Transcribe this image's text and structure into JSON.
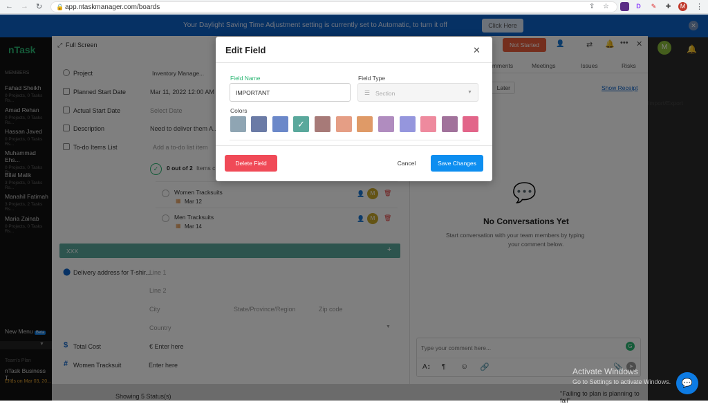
{
  "browser": {
    "url": "app.ntaskmanager.com/boards",
    "extensions": [
      "D",
      "M"
    ]
  },
  "banner": {
    "message": "Your Daylight Saving Time Adjustment setting is currently set to Automatic, to turn it off",
    "button": "Click Here"
  },
  "leftnav": {
    "logo": "nTask",
    "section": "MEMBERS",
    "members": [
      {
        "name": "Fahad Sheikh",
        "sub": "0 Projects, 0 Tasks Rs..."
      },
      {
        "name": "Amad Rehan",
        "sub": "0 Projects, 0 Tasks Rs..."
      },
      {
        "name": "Hassan Javed",
        "sub": "0 Projects, 0 Tasks Rs..."
      },
      {
        "name": "Muhammad Ehs...",
        "sub": "0 Projects, 0 Tasks Rs..."
      },
      {
        "name": "Bilal Malik",
        "sub": "3 Projects, 0 Tasks Rs..."
      },
      {
        "name": "Manahil Fatimah",
        "sub": "3 Projects, 2 Tasks Rs..."
      },
      {
        "name": "Maria Zainab",
        "sub": "0 Projects, 0 Tasks Rs..."
      }
    ],
    "new_menu": "New Menu",
    "beta": "Beta",
    "team_plan_label": "Team's Plan",
    "plan_name": "nTask Business T...",
    "plan_ends": "Ends on Mar 03, 20..."
  },
  "panel": {
    "full_screen": "Full Screen",
    "not_started": "Not Started",
    "avatar": "M",
    "tabs": [
      "Comments",
      "Meetings",
      "Issues",
      "Risks"
    ],
    "later": "Later",
    "show_receipt": "Show Receipt",
    "import_export": "Import/Export",
    "fields": [
      {
        "label": "Project",
        "value": "Inventory Manage..."
      },
      {
        "label": "Planned Start Date",
        "value": "Mar 11, 2022 12:00 AM"
      },
      {
        "label": "Actual Start Date",
        "value": "Select Date"
      },
      {
        "label": "Description",
        "value": "Need to deliver them A..."
      },
      {
        "label": "To-do Items List",
        "value": "Add a to-do list item"
      }
    ],
    "todo_progress": "0 out of 2",
    "todo_progress_suffix": "Items c...",
    "todos": [
      {
        "name": "Women Tracksuits",
        "date": "Mar 12"
      },
      {
        "name": "Men Tracksuits",
        "date": "Mar 14"
      }
    ],
    "section_bar": "XXX",
    "delivery_label": "Delivery address for T-shir...",
    "address": {
      "line1": "Line 1",
      "line2": "Line 2",
      "city": "City",
      "state": "State/Province/Region",
      "zip": "Zip code",
      "country": "Country"
    },
    "total_cost_label": "Total Cost",
    "total_cost_value": "€ Enter here",
    "women_tracksuit_label": "Women Tracksuit",
    "women_tracksuit_value": "Enter here",
    "no_conv_title": "No Conversations Yet",
    "no_conv_text_1": "Start conversation with your team members by typing",
    "no_conv_text_2": "your comment below.",
    "comment_placeholder": "Type your comment here...",
    "showing": "Showing 5 Status(s)",
    "quote": "\"Failing to plan is planning to fail\""
  },
  "activate": {
    "title": "Activate Windows",
    "sub": "Go to Settings to activate Windows."
  },
  "modal": {
    "title": "Edit Field",
    "field_name_label": "Field Name",
    "field_name_value": "IMPORTANT",
    "field_type_label": "Field Type",
    "field_type_value": "Section",
    "colors_label": "Colors",
    "colors": [
      "#8fa5b3",
      "#6b7ba6",
      "#6b88c9",
      "#5aa89c",
      "#a77a78",
      "#e59e85",
      "#df9a67",
      "#b08cbf",
      "#9596dd",
      "#ee8a9e",
      "#a1729b",
      "#e26589"
    ],
    "selected_color_index": 3,
    "delete_button": "Delete Field",
    "cancel_button": "Cancel",
    "save_button": "Save Changes"
  }
}
